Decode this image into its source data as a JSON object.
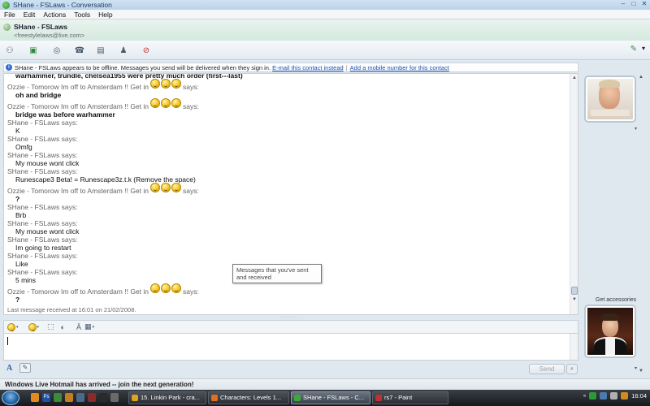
{
  "window": {
    "title": "SHane - FSLaws - Conversation",
    "controls": {
      "minimize": "–",
      "maximize": "□",
      "close": "✕"
    }
  },
  "menu": [
    "File",
    "Edit",
    "Actions",
    "Tools",
    "Help"
  ],
  "contact": {
    "name": "SHane - FSLaws",
    "email": "<freestylelaws@live.com>"
  },
  "toolbar_icons": [
    "invite-contact-icon",
    "share-files-icon",
    "video-call-icon",
    "call-icon",
    "activities-icon",
    "games-icon",
    "block-contact-icon"
  ],
  "notice": {
    "text": "SHane - FSLaws appears to be offline. Messages you send will be delivered when they sign in.",
    "link1": "E-mail this contact instead",
    "separator": "|",
    "link2": "Add a mobile number for this contact"
  },
  "conversation": {
    "first_partial": "warhammer, trundle, chelsea1955 were pretty much order (first---last)",
    "entries": [
      {
        "sender": "Ozzie - Tomorow Im off to Amsterdam !! Get in",
        "smileys": 3,
        "says": "says:",
        "message": "oh and bridge",
        "bold": true
      },
      {
        "sender": "Ozzie - Tomorow Im off to Amsterdam !! Get in",
        "smileys": 3,
        "says": "says:",
        "message": "bridge was before warhammer",
        "bold": true
      },
      {
        "sender": "SHane - FSLaws says:",
        "smileys": 0,
        "says": "",
        "message": "K",
        "bold": false
      },
      {
        "sender": "SHane - FSLaws says:",
        "smileys": 0,
        "says": "",
        "message": "Omfg",
        "bold": false
      },
      {
        "sender": "SHane - FSLaws says:",
        "smileys": 0,
        "says": "",
        "message": "My mouse wont click",
        "bold": false
      },
      {
        "sender": "SHane - FSLaws says:",
        "smileys": 0,
        "says": "",
        "message": "Runescape3 Beta! = Runescape3z.t.k  (Remove the space)",
        "bold": false
      },
      {
        "sender": "Ozzie - Tomorow Im off to Amsterdam !! Get in",
        "smileys": 3,
        "says": "says:",
        "message": "?",
        "bold": true
      },
      {
        "sender": "SHane - FSLaws says:",
        "smileys": 0,
        "says": "",
        "message": "Brb",
        "bold": false
      },
      {
        "sender": "SHane - FSLaws says:",
        "smileys": 0,
        "says": "",
        "message": "My mouse wont click",
        "bold": false
      },
      {
        "sender": "SHane - FSLaws says:",
        "smileys": 0,
        "says": "",
        "message": "Im going to restart",
        "bold": false
      },
      {
        "sender": "SHane - FSLaws says:",
        "smileys": 0,
        "says": "",
        "message": "Like",
        "bold": false
      },
      {
        "sender": "SHane - FSLaws says:",
        "smileys": 0,
        "says": "",
        "message": "5 mins",
        "bold": false
      },
      {
        "sender": "Ozzie - Tomorow Im off to Amsterdam !! Get in",
        "smileys": 3,
        "says": "says:",
        "message": "?",
        "bold": true
      }
    ],
    "last_received": "Last message received at 16:01 on 21/02/2008."
  },
  "tooltip": "Messages that you've sent and received",
  "format_toolbar": [
    "emoticon-icon",
    "wink-icon",
    "nudge-icon",
    "voice-clip-icon",
    "font-icon",
    "background-icon"
  ],
  "input": {
    "value": "",
    "placeholder": ""
  },
  "send_label": "Send",
  "accessories_label": "Get accessories",
  "banner": "Windows Live Hotmail has arrived -- join the next generation!",
  "taskbar": {
    "tasks": [
      {
        "label": "15. Linkin Park - cra...",
        "active": false,
        "color": "#e0a020"
      },
      {
        "label": "Characters: Levels 1...",
        "active": false,
        "color": "#e07020"
      },
      {
        "label": "SHane - FSLaws - C...",
        "active": true,
        "color": "#3fa83a"
      },
      {
        "label": "rs7 - Paint",
        "active": false,
        "color": "#c03030"
      }
    ],
    "clock": "16:04"
  },
  "colors": {
    "link": "#1a4fb0",
    "accent": "#2d8a2a"
  }
}
